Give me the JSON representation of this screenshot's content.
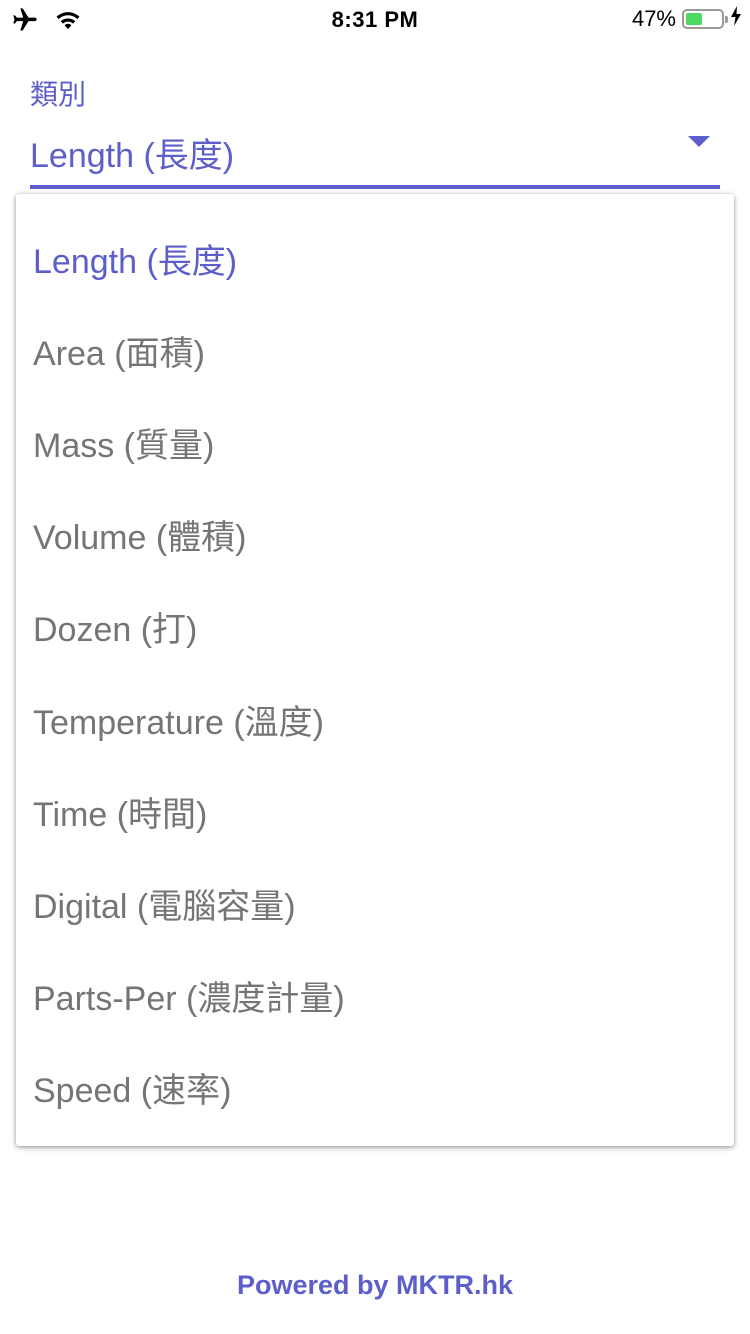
{
  "status_bar": {
    "left_icons": [
      "airplane-icon",
      "wifi-icon"
    ],
    "time": "8:31 PM",
    "battery_percent": "47%",
    "battery_level": 0.47,
    "right_icons": [
      "battery-icon",
      "charging-bolt-icon"
    ]
  },
  "category_field": {
    "label": "類別",
    "value": "Length (長度)",
    "arrow_icon": "dropdown-arrow-icon"
  },
  "dropdown": {
    "selected_index": 0,
    "items": [
      {
        "label": "Length (長度)"
      },
      {
        "label": "Area (面積)"
      },
      {
        "label": "Mass (質量)"
      },
      {
        "label": "Volume (體積)"
      },
      {
        "label": "Dozen (打)"
      },
      {
        "label": "Temperature (溫度)"
      },
      {
        "label": "Time (時間)"
      },
      {
        "label": "Digital (電腦容量)"
      },
      {
        "label": "Parts-Per (濃度計量)"
      },
      {
        "label": "Speed (速率)"
      }
    ]
  },
  "footer": {
    "text": "Powered by MKTR.hk"
  },
  "colors": {
    "accent": "#5c5fc9",
    "item_text": "#757575",
    "battery_fill": "#4cd964"
  }
}
